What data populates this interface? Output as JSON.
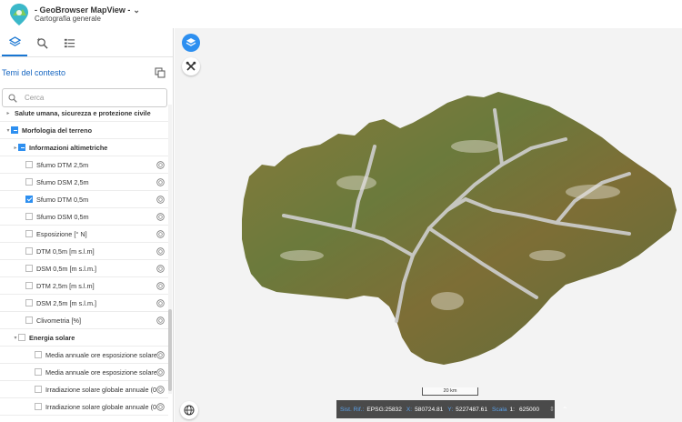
{
  "header": {
    "title": "- GeoBrowser MapView -",
    "subtitle": "Cartografia generale"
  },
  "sidebar": {
    "panel_title": "Temi del contesto",
    "search_placeholder": "Cerca",
    "tree": [
      {
        "label": "Salute umana, sicurezza e protezione civile",
        "indent": 0,
        "expander": "▸",
        "checkbox": "none",
        "bold": true,
        "info": false
      },
      {
        "label": "Morfologia del terreno",
        "indent": 0,
        "expander": "▾",
        "checkbox": "partial",
        "bold": true,
        "info": false
      },
      {
        "label": "Informazioni altimetriche",
        "indent": 1,
        "expander": "▸",
        "checkbox": "partial",
        "bold": true,
        "info": false
      },
      {
        "label": "Sfumo DTM 2,5m",
        "indent": 2,
        "expander": "",
        "checkbox": "unchecked",
        "bold": false,
        "info": true
      },
      {
        "label": "Sfumo DSM 2,5m",
        "indent": 2,
        "expander": "",
        "checkbox": "unchecked",
        "bold": false,
        "info": true
      },
      {
        "label": "Sfumo DTM 0,5m",
        "indent": 2,
        "expander": "",
        "checkbox": "checked",
        "bold": false,
        "info": true
      },
      {
        "label": "Sfumo DSM 0,5m",
        "indent": 2,
        "expander": "",
        "checkbox": "unchecked",
        "bold": false,
        "info": true
      },
      {
        "label": "Esposizione [° N]",
        "indent": 2,
        "expander": "",
        "checkbox": "unchecked",
        "bold": false,
        "info": true
      },
      {
        "label": "DTM 0,5m [m s.l.m]",
        "indent": 2,
        "expander": "",
        "checkbox": "unchecked",
        "bold": false,
        "info": true
      },
      {
        "label": "DSM 0,5m [m s.l.m.]",
        "indent": 2,
        "expander": "",
        "checkbox": "unchecked",
        "bold": false,
        "info": true
      },
      {
        "label": "DTM 2,5m [m s.l.m]",
        "indent": 2,
        "expander": "",
        "checkbox": "unchecked",
        "bold": false,
        "info": true
      },
      {
        "label": "DSM 2,5m [m s.l.m.]",
        "indent": 2,
        "expander": "",
        "checkbox": "unchecked",
        "bold": false,
        "info": true
      },
      {
        "label": "Clivometria [%]",
        "indent": 2,
        "expander": "",
        "checkbox": "unchecked",
        "bold": false,
        "info": true
      },
      {
        "label": "Energia solare",
        "indent": 1,
        "expander": "▾",
        "checkbox": "unchecked",
        "bold": true,
        "info": false
      },
      {
        "label": "Media annuale ore esposizione solare (0...",
        "indent": 3,
        "expander": "",
        "checkbox": "unchecked",
        "bold": false,
        "info": true
      },
      {
        "label": "Media annuale ore esposizione solare (0...",
        "indent": 3,
        "expander": "",
        "checkbox": "unchecked",
        "bold": false,
        "info": true
      },
      {
        "label": "Irradiazione solare globale annuale (0,5...",
        "indent": 3,
        "expander": "",
        "checkbox": "unchecked",
        "bold": false,
        "info": true
      },
      {
        "label": "Irradiazione solare globale annuale (0,5...",
        "indent": 3,
        "expander": "",
        "checkbox": "unchecked",
        "bold": false,
        "info": true
      }
    ]
  },
  "map": {
    "scalebar_label": "20 km",
    "coords": {
      "srs_label": "Sist. Rif.:",
      "srs_value": "EPSG:25832",
      "x_label": "X:",
      "x_value": "580724.81",
      "y_label": "Y:",
      "y_value": "5227487.61",
      "scale_label": "Scala",
      "scale_prefix": "1:",
      "scale_value": "625000"
    }
  },
  "colors": {
    "accent": "#2d8ff0",
    "link": "#1565c0",
    "coordbar_bg": "#4a4a4a"
  },
  "icons": [
    "logo-icon",
    "layers-tab-icon",
    "search-tab-icon",
    "legend-tab-icon",
    "copy-icon",
    "search-icon",
    "info-icon",
    "layers-icon",
    "tools-icon",
    "globe-icon"
  ]
}
